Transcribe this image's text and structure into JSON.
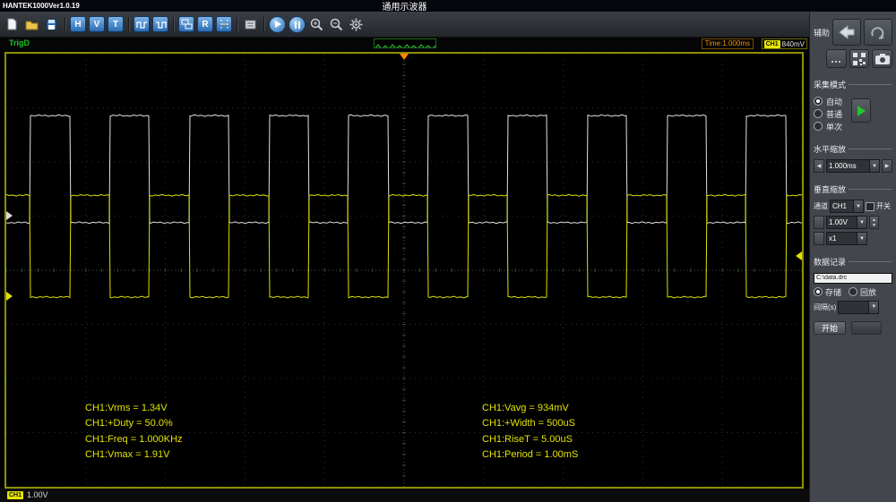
{
  "title_bar": {
    "app_version": "HANTEK1000Ver1.0.19",
    "title": "通用示波器"
  },
  "toolbar": {
    "h_label": "H",
    "v_label": "V",
    "t_label": "T",
    "r_label": "R",
    "icons": [
      "new-file",
      "open-folder",
      "save",
      "horizontal-menu",
      "vertical-menu",
      "trigger-menu",
      "waveform-square-1",
      "waveform-square-2",
      "window-tiles",
      "refresh",
      "cursor-measure",
      "auto-measure",
      "play",
      "pause",
      "zoom-in",
      "zoom-out",
      "settings-gear"
    ]
  },
  "status_bar": {
    "trigger_status": "TrigD",
    "time_base": "Time:1.000ms",
    "channel_badge": "CH1",
    "trigger_level": "840mV"
  },
  "bottom_bar": {
    "channel_badge": "CH1",
    "volts_per_div": "1.00V"
  },
  "sidebar": {
    "aux_title": "辅助",
    "acquisition": {
      "title": "采集模式",
      "options": [
        {
          "label": "自动",
          "selected": true
        },
        {
          "label": "普通",
          "selected": false
        },
        {
          "label": "单次",
          "selected": false
        }
      ]
    },
    "horizontal": {
      "title": "水平缩放",
      "timebase": "1.000ms"
    },
    "vertical": {
      "title": "垂直缩放",
      "channel_label": "通道",
      "channel": "CH1",
      "switch_label": "开关",
      "scale": "1.00V",
      "probe": "x1"
    },
    "datalog": {
      "title": "数据记录",
      "path": "C:\\data.drc",
      "modes": [
        {
          "label": "存储",
          "selected": true
        },
        {
          "label": "回放",
          "selected": false
        }
      ],
      "interval_label": "间隔(s)",
      "start_label": "开始"
    }
  },
  "chart_data": {
    "type": "line",
    "title": "Oscilloscope dual square-wave traces",
    "x_divisions": 10,
    "y_divisions": 8,
    "timebase_per_div": "1.000ms",
    "ch1_volts_per_div": "1.00V",
    "series": [
      {
        "name": "white-trace",
        "color": "#e2e2e2",
        "period_frac": 0.1,
        "duty": 0.5,
        "phase_frac": 0.03,
        "high_frac": 0.143,
        "low_frac": 0.39
      },
      {
        "name": "ch1-yellow-trace",
        "color": "#e0e000",
        "period_frac": 0.1,
        "duty": 0.5,
        "phase_frac": 0.08,
        "high_frac": 0.327,
        "low_frac": 0.562
      }
    ],
    "measurements_left": [
      "CH1:Vrms = 1.34V",
      "CH1:+Duty = 50.0%",
      "CH1:Freq = 1.000KHz",
      "CH1:Vmax = 1.91V"
    ],
    "measurements_right": [
      "CH1:Vavg = 934mV",
      "CH1:+Width = 500uS",
      "CH1:RiseT = 5.00uS",
      "CH1:Period = 1.00mS"
    ]
  }
}
